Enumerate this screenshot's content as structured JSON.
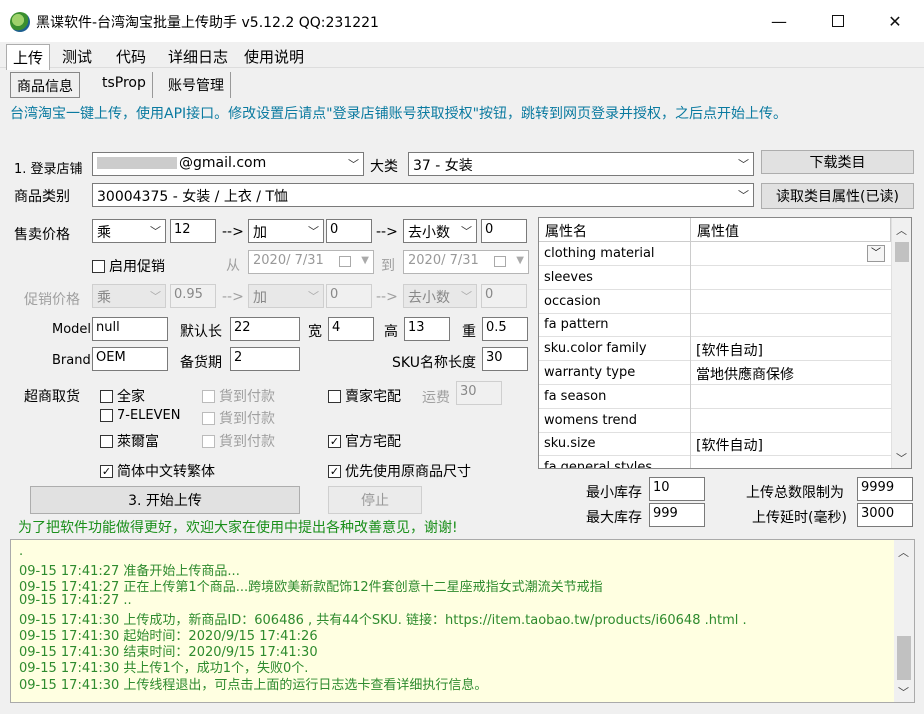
{
  "window": {
    "title": "黑谍软件-台湾淘宝批量上传助手 v5.12.2 QQ:231221",
    "minimize": "—",
    "close": "✕"
  },
  "menu": [
    "上传",
    "测试",
    "代码",
    "详细日志",
    "使用说明"
  ],
  "subtabs": [
    "商品信息",
    "tsProp",
    "账号管理"
  ],
  "notice": "台湾淘宝一键上传，使用API接口。修改设置后请点\"登录店铺账号获取授权\"按钮，跳转到网页登录并授权，之后点开始上传。",
  "store": {
    "label": "1. 登录店铺",
    "value": "@gmail.com",
    "category_label": "大类",
    "category_value": "37 - 女装",
    "download_btn": "下载类目"
  },
  "product_category": {
    "label": "商品类别",
    "value": "30004375 - 女装 / 上衣 / T恤",
    "read_btn": "读取类目属性(已读)"
  },
  "price": {
    "label": "售卖价格",
    "op": "乘",
    "num": "12",
    "arrow1": "-->",
    "op2": "加",
    "num2": "0",
    "arrow2": "-->",
    "round": "去小数",
    "num3": "0"
  },
  "promo": {
    "enable_label": "启用促销",
    "from": "从",
    "date_from": "2020/ 7/31",
    "to": "到",
    "date_to": "2020/ 7/31",
    "label": "促销价格",
    "op": "乘",
    "num": "0.95",
    "arrow1": "-->",
    "op2": "加",
    "num2": "0",
    "arrow2": "-->",
    "round": "去小数",
    "num3": "0"
  },
  "fields": {
    "model_label": "Model",
    "model_value": "null",
    "length_label": "默认长",
    "length_value": "22",
    "width_label": "宽",
    "width_value": "4",
    "height_label": "高",
    "height_value": "13",
    "weight_label": "重",
    "weight_value": "0.5",
    "brand_label": "Brand",
    "brand_value": "OEM",
    "stock_label": "备货期",
    "stock_value": "2",
    "sku_label": "SKU名称长度",
    "sku_value": "30"
  },
  "shipping": {
    "label": "超商取货",
    "items": [
      "全家",
      "7-ELEVEN",
      "萊爾富"
    ],
    "cod": "貨到付款",
    "seller_delivery": "賣家宅配",
    "fee_label": "运费",
    "fee_value": "30",
    "official": "官方宅配",
    "check": "✓"
  },
  "options": {
    "simplified": "简体中文转繁体",
    "original_size": "优先使用原商品尺寸"
  },
  "buttons": {
    "start": "3. 开始上传",
    "stop": "停止"
  },
  "limits": {
    "min_stock_label": "最小库存",
    "min_stock": "10",
    "max_stock_label": "最大库存",
    "max_stock": "999",
    "total_label": "上传总数限制为",
    "total": "9999",
    "delay_label": "上传延时(毫秒)",
    "delay": "3000"
  },
  "feedback": "为了把软件功能做得更好，欢迎大家在使用中提出各种改善意见，谢谢!",
  "grid": {
    "col_name": "属性名",
    "col_value": "属性值",
    "rows": [
      {
        "name": "clothing material",
        "value": ""
      },
      {
        "name": "sleeves",
        "value": ""
      },
      {
        "name": "occasion",
        "value": ""
      },
      {
        "name": "fa pattern",
        "value": ""
      },
      {
        "name": "sku.color family",
        "value": "[软件自动]"
      },
      {
        "name": "warranty type",
        "value": "當地供應商保修"
      },
      {
        "name": "fa season",
        "value": ""
      },
      {
        "name": "womens trend",
        "value": ""
      },
      {
        "name": "sku.size",
        "value": "[软件自动]"
      },
      {
        "name": "fa general styles",
        "value": ""
      }
    ]
  },
  "log": [
    ".",
    "09-15 17:41:27  准备开始上传商品...",
    "09-15 17:41:27  正在上传第1个商品...跨境欧美新款配饰12件套创意十二星座戒指女式潮流关节戒指",
    "09-15 17:41:27  ..",
    "09-15 17:41:30  上传成功，新商品ID：606486      , 共有44个SKU. 链接：https://item.taobao.tw/products/i60648        .html  .",
    "09-15 17:41:30  起始时间：2020/9/15 17:41:26",
    "09-15 17:41:30  结束时间：2020/9/15 17:41:30",
    "09-15 17:41:30  共上传1个，成功1个，失败0个.",
    "09-15 17:41:30  上传线程退出，可点击上面的运行日志选卡查看详细执行信息。"
  ],
  "colors": {
    "notice": "#0a7aa0",
    "log_text": "#2e8b2e",
    "log_bg": "#ffffe1"
  }
}
